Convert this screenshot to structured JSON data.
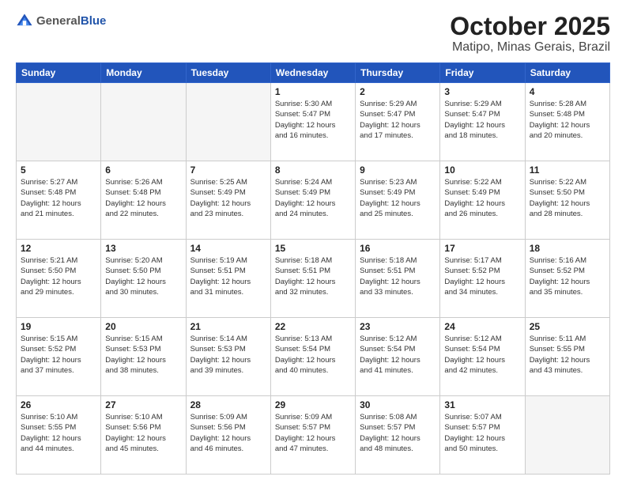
{
  "logo": {
    "general": "General",
    "blue": "Blue"
  },
  "title": "October 2025",
  "subtitle": "Matipo, Minas Gerais, Brazil",
  "days_of_week": [
    "Sunday",
    "Monday",
    "Tuesday",
    "Wednesday",
    "Thursday",
    "Friday",
    "Saturday"
  ],
  "weeks": [
    [
      {
        "day": "",
        "info": ""
      },
      {
        "day": "",
        "info": ""
      },
      {
        "day": "",
        "info": ""
      },
      {
        "day": "1",
        "info": "Sunrise: 5:30 AM\nSunset: 5:47 PM\nDaylight: 12 hours\nand 16 minutes."
      },
      {
        "day": "2",
        "info": "Sunrise: 5:29 AM\nSunset: 5:47 PM\nDaylight: 12 hours\nand 17 minutes."
      },
      {
        "day": "3",
        "info": "Sunrise: 5:29 AM\nSunset: 5:47 PM\nDaylight: 12 hours\nand 18 minutes."
      },
      {
        "day": "4",
        "info": "Sunrise: 5:28 AM\nSunset: 5:48 PM\nDaylight: 12 hours\nand 20 minutes."
      }
    ],
    [
      {
        "day": "5",
        "info": "Sunrise: 5:27 AM\nSunset: 5:48 PM\nDaylight: 12 hours\nand 21 minutes."
      },
      {
        "day": "6",
        "info": "Sunrise: 5:26 AM\nSunset: 5:48 PM\nDaylight: 12 hours\nand 22 minutes."
      },
      {
        "day": "7",
        "info": "Sunrise: 5:25 AM\nSunset: 5:49 PM\nDaylight: 12 hours\nand 23 minutes."
      },
      {
        "day": "8",
        "info": "Sunrise: 5:24 AM\nSunset: 5:49 PM\nDaylight: 12 hours\nand 24 minutes."
      },
      {
        "day": "9",
        "info": "Sunrise: 5:23 AM\nSunset: 5:49 PM\nDaylight: 12 hours\nand 25 minutes."
      },
      {
        "day": "10",
        "info": "Sunrise: 5:22 AM\nSunset: 5:49 PM\nDaylight: 12 hours\nand 26 minutes."
      },
      {
        "day": "11",
        "info": "Sunrise: 5:22 AM\nSunset: 5:50 PM\nDaylight: 12 hours\nand 28 minutes."
      }
    ],
    [
      {
        "day": "12",
        "info": "Sunrise: 5:21 AM\nSunset: 5:50 PM\nDaylight: 12 hours\nand 29 minutes."
      },
      {
        "day": "13",
        "info": "Sunrise: 5:20 AM\nSunset: 5:50 PM\nDaylight: 12 hours\nand 30 minutes."
      },
      {
        "day": "14",
        "info": "Sunrise: 5:19 AM\nSunset: 5:51 PM\nDaylight: 12 hours\nand 31 minutes."
      },
      {
        "day": "15",
        "info": "Sunrise: 5:18 AM\nSunset: 5:51 PM\nDaylight: 12 hours\nand 32 minutes."
      },
      {
        "day": "16",
        "info": "Sunrise: 5:18 AM\nSunset: 5:51 PM\nDaylight: 12 hours\nand 33 minutes."
      },
      {
        "day": "17",
        "info": "Sunrise: 5:17 AM\nSunset: 5:52 PM\nDaylight: 12 hours\nand 34 minutes."
      },
      {
        "day": "18",
        "info": "Sunrise: 5:16 AM\nSunset: 5:52 PM\nDaylight: 12 hours\nand 35 minutes."
      }
    ],
    [
      {
        "day": "19",
        "info": "Sunrise: 5:15 AM\nSunset: 5:52 PM\nDaylight: 12 hours\nand 37 minutes."
      },
      {
        "day": "20",
        "info": "Sunrise: 5:15 AM\nSunset: 5:53 PM\nDaylight: 12 hours\nand 38 minutes."
      },
      {
        "day": "21",
        "info": "Sunrise: 5:14 AM\nSunset: 5:53 PM\nDaylight: 12 hours\nand 39 minutes."
      },
      {
        "day": "22",
        "info": "Sunrise: 5:13 AM\nSunset: 5:54 PM\nDaylight: 12 hours\nand 40 minutes."
      },
      {
        "day": "23",
        "info": "Sunrise: 5:12 AM\nSunset: 5:54 PM\nDaylight: 12 hours\nand 41 minutes."
      },
      {
        "day": "24",
        "info": "Sunrise: 5:12 AM\nSunset: 5:54 PM\nDaylight: 12 hours\nand 42 minutes."
      },
      {
        "day": "25",
        "info": "Sunrise: 5:11 AM\nSunset: 5:55 PM\nDaylight: 12 hours\nand 43 minutes."
      }
    ],
    [
      {
        "day": "26",
        "info": "Sunrise: 5:10 AM\nSunset: 5:55 PM\nDaylight: 12 hours\nand 44 minutes."
      },
      {
        "day": "27",
        "info": "Sunrise: 5:10 AM\nSunset: 5:56 PM\nDaylight: 12 hours\nand 45 minutes."
      },
      {
        "day": "28",
        "info": "Sunrise: 5:09 AM\nSunset: 5:56 PM\nDaylight: 12 hours\nand 46 minutes."
      },
      {
        "day": "29",
        "info": "Sunrise: 5:09 AM\nSunset: 5:57 PM\nDaylight: 12 hours\nand 47 minutes."
      },
      {
        "day": "30",
        "info": "Sunrise: 5:08 AM\nSunset: 5:57 PM\nDaylight: 12 hours\nand 48 minutes."
      },
      {
        "day": "31",
        "info": "Sunrise: 5:07 AM\nSunset: 5:57 PM\nDaylight: 12 hours\nand 50 minutes."
      },
      {
        "day": "",
        "info": ""
      }
    ]
  ]
}
